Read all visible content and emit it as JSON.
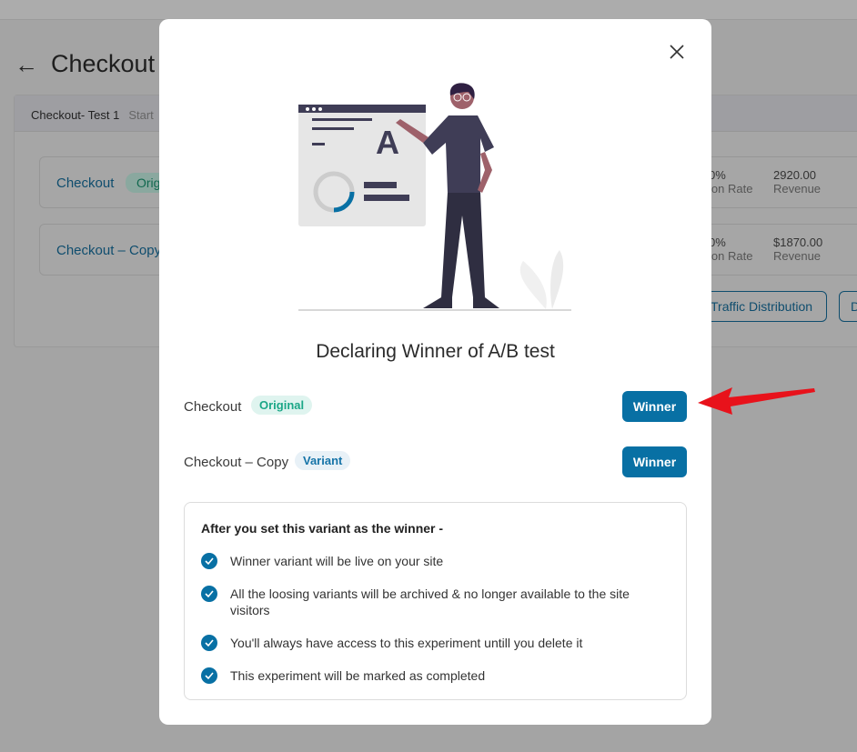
{
  "background": {
    "page_title": "Checkout",
    "test_name": "Checkout- Test 1",
    "test_status": "Start",
    "variants": [
      {
        "name": "Checkout",
        "badge": "Orig",
        "rate_value": "0%",
        "rate_label": "ion Rate",
        "revenue_value": "2920.00",
        "revenue_label": "Revenue"
      },
      {
        "name": "Checkout – Copy",
        "rate_value": "0%",
        "rate_label": "ion Rate",
        "revenue_value": "$1870.00",
        "revenue_label": "Revenue"
      }
    ],
    "traffic_button": "Traffic Distribution",
    "other_button": "D"
  },
  "modal": {
    "title": "Declaring Winner of A/B test",
    "illustration_letter": "A",
    "rows": [
      {
        "name": "Checkout",
        "badge": "Original",
        "button": "Winner"
      },
      {
        "name": "Checkout – Copy",
        "badge": "Variant",
        "button": "Winner"
      }
    ],
    "info_heading": "After you set this variant as the winner -",
    "info_items": [
      "Winner variant will be live on your site",
      "All the loosing variants will be archived & no longer available to the site visitors",
      "You'll always have access to this experiment untill you delete it",
      "This experiment will be marked as completed"
    ]
  },
  "colors": {
    "primary": "#0870a4",
    "original_badge": "#1ba787",
    "arrow": "#e8121b"
  }
}
